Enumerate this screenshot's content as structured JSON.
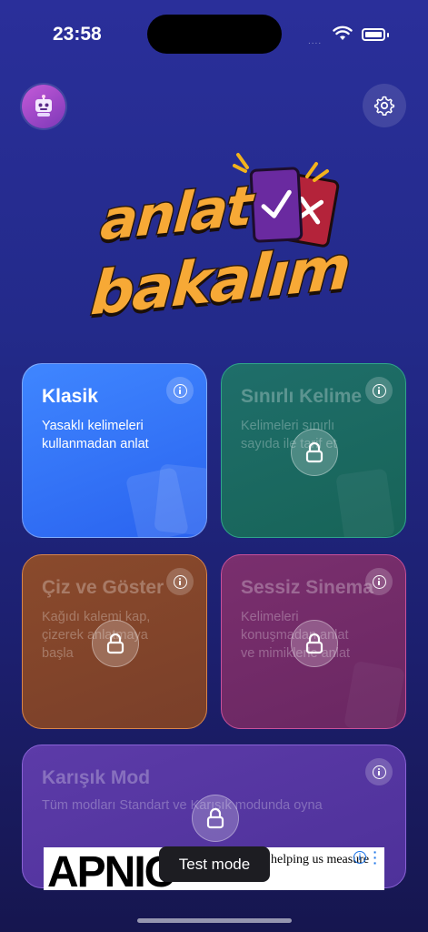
{
  "status_bar": {
    "time": "23:58",
    "signal": "....",
    "icons": [
      "wifi-icon",
      "battery-icon"
    ]
  },
  "header": {
    "left_icon": "robot-icon",
    "right_icon": "gear-icon"
  },
  "logo": {
    "line1": "anlat",
    "line2": "bakalım",
    "icons": [
      "check-card-icon",
      "cross-card-icon"
    ]
  },
  "modes": [
    {
      "title": "Klasik",
      "description": "Yasaklı kelimeleri kullanmadan anlat",
      "locked": false,
      "color": "#3a7bff"
    },
    {
      "title": "Sınırlı Kelime",
      "description": "Kelimeleri sınırlı sayıda ile tarif et",
      "locked": true,
      "color": "#1f6e6a"
    },
    {
      "title": "Çiz ve Göster",
      "description": "Kağıdı kalemi kap, çizerek anlatmaya başla",
      "locked": true,
      "color": "#8a4a2c"
    },
    {
      "title": "Sessiz Sinema",
      "description": "Kelimeleri konuşmadan anlat ve mimiklerle anlat",
      "locked": true,
      "color": "#7a2f6e"
    },
    {
      "title": "Karışık Mod",
      "description": "Tüm modları Standart ve Karışık modunda oyna",
      "locked": true,
      "color": "#5c3ba8"
    }
  ],
  "ad": {
    "brand": "APNIC",
    "text": "helping us measure",
    "badge": "i"
  },
  "toast": {
    "label": "Test mode"
  },
  "colors": {
    "background_top": "#2a2f9a",
    "background_bottom": "#16164f",
    "logo": "#f7a936"
  }
}
